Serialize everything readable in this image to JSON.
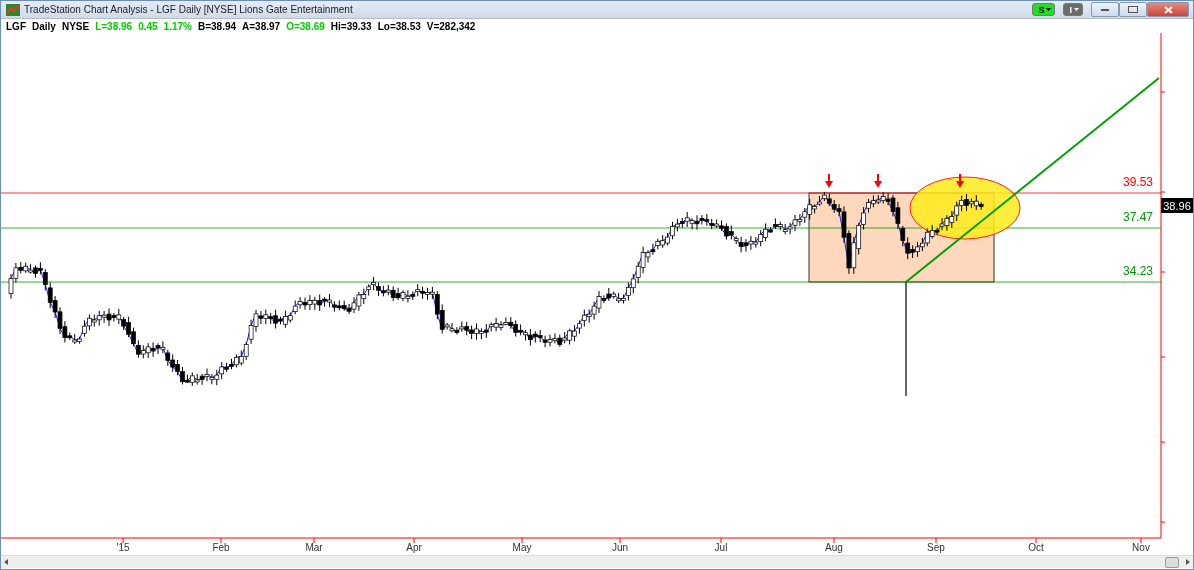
{
  "window": {
    "title": "TradeStation Chart Analysis - LGF Daily [NYSE] Lions Gate Entertainment"
  },
  "toolbar_buttons": [
    {
      "label": "S",
      "kind": "strategy"
    },
    {
      "label": "I",
      "kind": "indicator"
    }
  ],
  "legend": [
    {
      "text": "LGF",
      "color": "#000000"
    },
    {
      "text": "Daily",
      "color": "#000000"
    },
    {
      "text": "NYSE",
      "color": "#000000"
    },
    {
      "text": "L=38.96",
      "color": "#00cc00"
    },
    {
      "text": "0.45",
      "color": "#00cc00"
    },
    {
      "text": "1.17%",
      "color": "#00cc00"
    },
    {
      "text": "B=38.94",
      "color": "#000000"
    },
    {
      "text": "A=38.97",
      "color": "#000000"
    },
    {
      "text": "O=38.69",
      "color": "#00cc00"
    },
    {
      "text": "Hi=39.33",
      "color": "#000000"
    },
    {
      "text": "Lo=38.53",
      "color": "#000000"
    },
    {
      "text": "V=282,342",
      "color": "#000000"
    }
  ],
  "price_levels": [
    {
      "label": "39.53",
      "color": "#ff0000"
    },
    {
      "label": "37.47",
      "color": "#009900"
    },
    {
      "label": "34.23",
      "color": "#009900"
    }
  ],
  "last_price": "38.96",
  "x_axis": [
    "'15",
    "Feb",
    "Mar",
    "Apr",
    "May",
    "Jun",
    "Jul",
    "Aug",
    "Sep",
    "Oct",
    "Nov"
  ]
}
